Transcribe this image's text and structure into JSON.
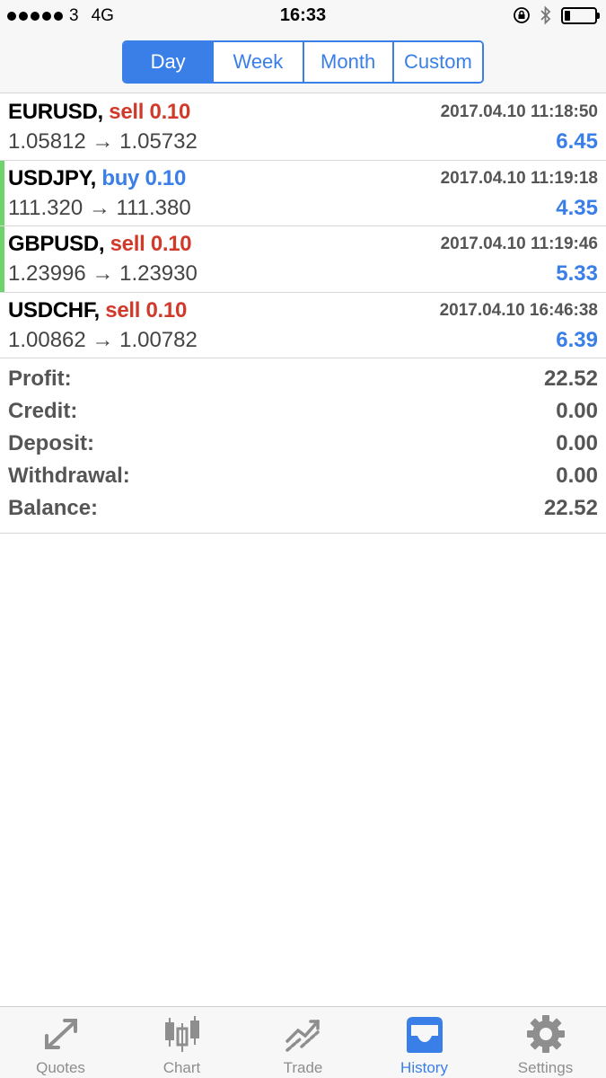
{
  "status_bar": {
    "carrier": "3",
    "network": "4G",
    "time": "16:33",
    "battery_level": 0.2
  },
  "period_tabs": [
    {
      "label": "Day",
      "active": true
    },
    {
      "label": "Week",
      "active": false
    },
    {
      "label": "Month",
      "active": false
    },
    {
      "label": "Custom",
      "active": false
    }
  ],
  "deals": [
    {
      "symbol": "EURUSD,",
      "type": "sell",
      "volume": "0.10",
      "time": "2017.04.10 11:18:50",
      "prices": "1.05812 → 1.05732",
      "profit": "6.45"
    },
    {
      "symbol": "USDJPY,",
      "type": "buy",
      "volume": "0.10",
      "time": "2017.04.10 11:19:18",
      "prices": "111.320 → 111.380",
      "profit": "4.35"
    },
    {
      "symbol": "GBPUSD,",
      "type": "sell",
      "volume": "0.10",
      "time": "2017.04.10 11:19:46",
      "prices": "1.23996 → 1.23930",
      "profit": "5.33"
    },
    {
      "symbol": "USDCHF,",
      "type": "sell",
      "volume": "0.10",
      "time": "2017.04.10 16:46:38",
      "prices": "1.00862 → 1.00782",
      "profit": "6.39"
    }
  ],
  "summary": [
    {
      "label": "Profit:",
      "value": "22.52"
    },
    {
      "label": "Credit:",
      "value": "0.00"
    },
    {
      "label": "Deposit:",
      "value": "0.00"
    },
    {
      "label": "Withdrawal:",
      "value": "0.00"
    },
    {
      "label": "Balance:",
      "value": "22.52"
    }
  ],
  "tabbar": [
    {
      "label": "Quotes",
      "icon": "quotes-arrows-icon",
      "active": false
    },
    {
      "label": "Chart",
      "icon": "candlestick-chart-icon",
      "active": false
    },
    {
      "label": "Trade",
      "icon": "trend-line-icon",
      "active": false
    },
    {
      "label": "History",
      "icon": "inbox-tray-icon",
      "active": true
    },
    {
      "label": "Settings",
      "icon": "gear-icon",
      "active": false
    }
  ],
  "colors": {
    "accent": "#3a7ee8",
    "sell": "#d13a2a",
    "buy": "#3a7ee8",
    "marker": "#6dd36a"
  }
}
